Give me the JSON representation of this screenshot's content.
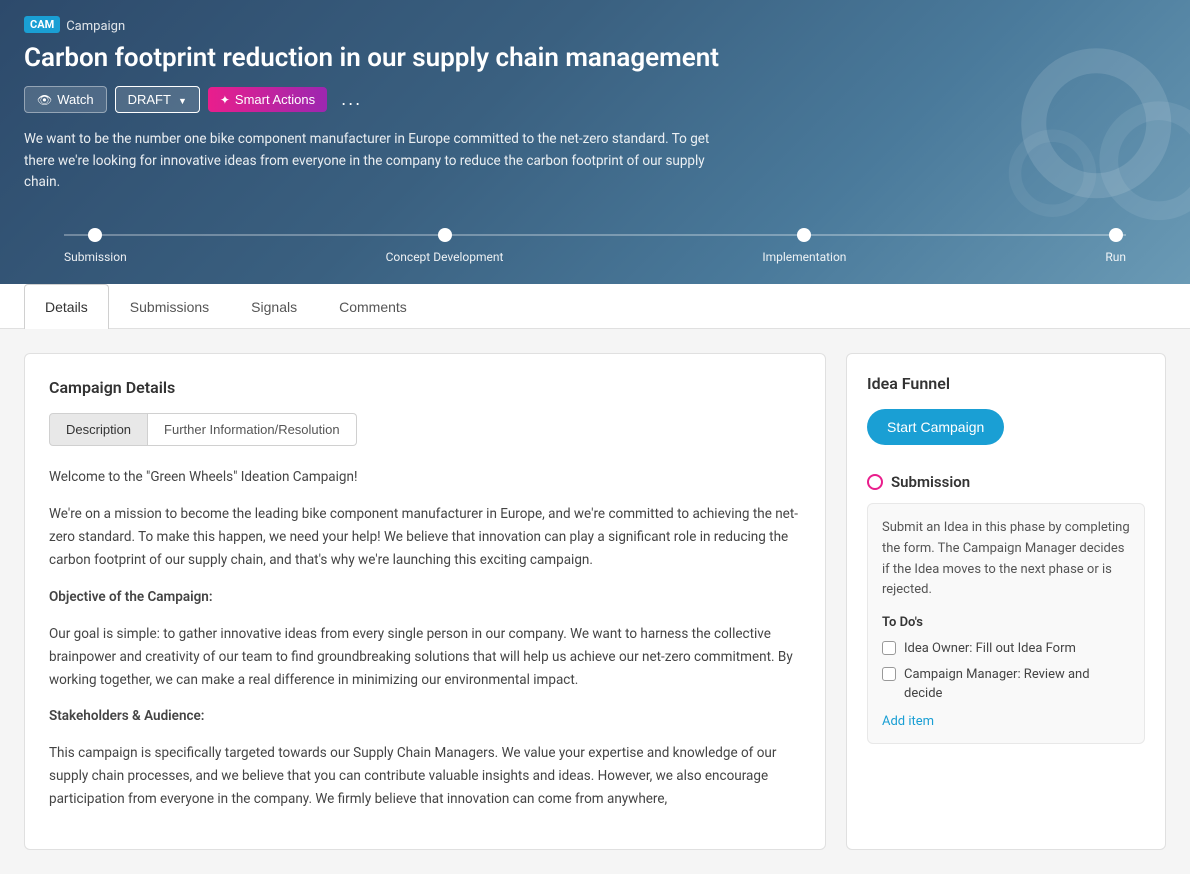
{
  "header": {
    "cam_badge": "CAM",
    "campaign_label": "Campaign",
    "title": "Carbon footprint reduction in our supply chain management",
    "watch_label": "Watch",
    "draft_label": "DRAFT",
    "smart_actions_label": "Smart Actions",
    "more_label": "...",
    "description": "We want to be the number one bike component manufacturer in Europe committed to the net-zero standard. To get there we're looking for innovative ideas from everyone in the company to reduce the carbon footprint of our supply chain."
  },
  "progress": {
    "steps": [
      {
        "label": "Submission"
      },
      {
        "label": "Concept Development"
      },
      {
        "label": "Implementation"
      },
      {
        "label": "Run"
      }
    ]
  },
  "tabs": [
    {
      "label": "Details",
      "active": true
    },
    {
      "label": "Submissions",
      "active": false
    },
    {
      "label": "Signals",
      "active": false
    },
    {
      "label": "Comments",
      "active": false
    }
  ],
  "campaign_details": {
    "section_title": "Campaign Details",
    "sub_tabs": [
      {
        "label": "Description",
        "active": true
      },
      {
        "label": "Further Information/Resolution",
        "active": false
      }
    ],
    "paragraphs": [
      "Welcome to the \"Green Wheels\" Ideation Campaign!",
      "We're on a mission to become the leading bike component manufacturer in Europe, and we're committed to achieving the net-zero standard. To make this happen, we need your help! We believe that innovation can play a significant role in reducing the carbon footprint of our supply chain, and that's why we're launching this exciting campaign.",
      "Objective of the Campaign:",
      "Our goal is simple: to gather innovative ideas from every single person in our company. We want to harness the collective brainpower and creativity of our team to find groundbreaking solutions that will help us achieve our net-zero commitment. By working together, we can make a real difference in minimizing our environmental impact.",
      "Stakeholders & Audience:",
      "This campaign is specifically targeted towards our Supply Chain Managers. We value your expertise and knowledge of our supply chain processes, and we believe that you can contribute valuable insights and ideas. However, we also encourage participation from everyone in the company. We firmly believe that innovation can come from anywhere,"
    ]
  },
  "idea_funnel": {
    "title": "Idea Funnel",
    "start_campaign_label": "Start Campaign",
    "phase_name": "Submission",
    "phase_description": "Submit an Idea in this phase by completing the form. The Campaign Manager decides if the Idea moves to the next phase or is rejected.",
    "todos_title": "To Do's",
    "todo_items": [
      {
        "label": "Idea Owner: Fill out Idea Form"
      },
      {
        "label": "Campaign Manager: Review and decide"
      }
    ],
    "add_item_label": "Add item"
  }
}
